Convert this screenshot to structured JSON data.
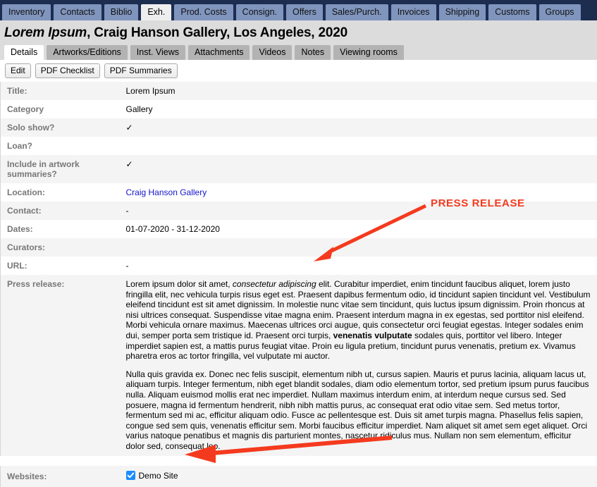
{
  "main_nav": {
    "active": "Exh.",
    "tabs": [
      {
        "label": "Inventory"
      },
      {
        "label": "Contacts"
      },
      {
        "label": "Biblio"
      },
      {
        "label": "Exh."
      },
      {
        "label": "Prod. Costs"
      },
      {
        "label": "Consign."
      },
      {
        "label": "Offers"
      },
      {
        "label": "Sales/Purch."
      },
      {
        "label": "Invoices"
      },
      {
        "label": "Shipping"
      },
      {
        "label": "Customs"
      },
      {
        "label": "Groups"
      }
    ]
  },
  "header": {
    "title_italic": "Lorem Ipsum",
    "title_rest": ", Craig Hanson Gallery, Los Angeles, 2020"
  },
  "sub_nav": {
    "active": "Details",
    "tabs": [
      {
        "label": "Details"
      },
      {
        "label": "Artworks/Editions"
      },
      {
        "label": "Inst. Views"
      },
      {
        "label": "Attachments"
      },
      {
        "label": "Videos"
      },
      {
        "label": "Notes"
      },
      {
        "label": "Viewing rooms"
      }
    ]
  },
  "toolbar": {
    "buttons": [
      {
        "label": "Edit"
      },
      {
        "label": "PDF Checklist"
      },
      {
        "label": "PDF Summaries"
      }
    ]
  },
  "details": {
    "rows": [
      {
        "label": "Title:",
        "value": "Lorem Ipsum"
      },
      {
        "label": "Category",
        "value": "Gallery"
      },
      {
        "label": "Solo show?",
        "value": "✓"
      },
      {
        "label": "Loan?",
        "value": ""
      },
      {
        "label": "Include in artwork summaries?",
        "value": "✓"
      },
      {
        "label": "Location:",
        "value": "Craig Hanson Gallery",
        "link": true
      },
      {
        "label": "Contact:",
        "value": "-"
      },
      {
        "label": "Dates:",
        "value": "01-07-2020 - 31-12-2020"
      },
      {
        "label": "Curators:",
        "value": ""
      },
      {
        "label": "URL:",
        "value": "-"
      }
    ],
    "press_release": {
      "label": "Press release:",
      "paragraph1": {
        "part1": "Lorem ipsum dolor sit amet, ",
        "italic1": "consectetur adipiscing",
        "part2": " elit. Curabitur imperdiet, enim tincidunt faucibus aliquet, lorem justo fringilla elit, nec vehicula turpis risus eget est. Praesent dapibus fermentum odio, id tincidunt sapien tincidunt vel. Vestibulum eleifend tincidunt est sit amet dignissim. In molestie nunc vitae sem tincidunt, quis luctus ipsum dignissim. Proin rhoncus at nisi ultrices consequat. Suspendisse vitae magna enim. Praesent interdum magna in ex egestas, sed porttitor nisl eleifend. Morbi vehicula ornare maximus. Maecenas ultrices orci augue, quis consectetur orci feugiat egestas. Integer sodales enim dui, semper porta sem tristique id. Praesent orci turpis, ",
        "bold1": "venenatis vulputate",
        "part3": " sodales quis, porttitor vel libero. Integer imperdiet sapien est, a mattis purus feugiat vitae. Proin eu ligula pretium, tincidunt purus venenatis, pretium ex. Vivamus pharetra eros ac tortor fringilla, vel vulputate mi auctor."
      },
      "paragraph2": "Nulla quis gravida ex. Donec nec felis suscipit, elementum nibh ut, cursus sapien. Mauris et purus lacinia, aliquam lacus ut, aliquam turpis. Integer fermentum, nibh eget blandit sodales, diam odio elementum tortor, sed pretium ipsum purus faucibus nulla. Aliquam euismod mollis erat nec imperdiet. Nullam maximus interdum enim, at interdum neque cursus sed. Sed posuere, magna id fermentum hendrerit, nibh nibh mattis purus, ac consequat erat odio vitae sem. Sed metus tortor, fermentum sed mi ac, efficitur aliquam odio. Fusce ac pellentesque est. Duis sit amet turpis magna. Phasellus felis sapien, congue sed sem quis, venenatis efficitur sem. Morbi faucibus efficitur imperdiet. Nam aliquet sit amet sem eget aliquet. Orci varius natoque penatibus et magnis dis parturient montes, nascetur ridiculus mus. Nullam non sem elementum, efficitur dolor sed, consequat leo."
    },
    "websites": {
      "label": "Websites:",
      "checkbox_label": "Demo Site",
      "checked": true
    }
  },
  "annotations": {
    "press_release_callout": "PRESS RELEASE",
    "color": "#f43a1e"
  }
}
